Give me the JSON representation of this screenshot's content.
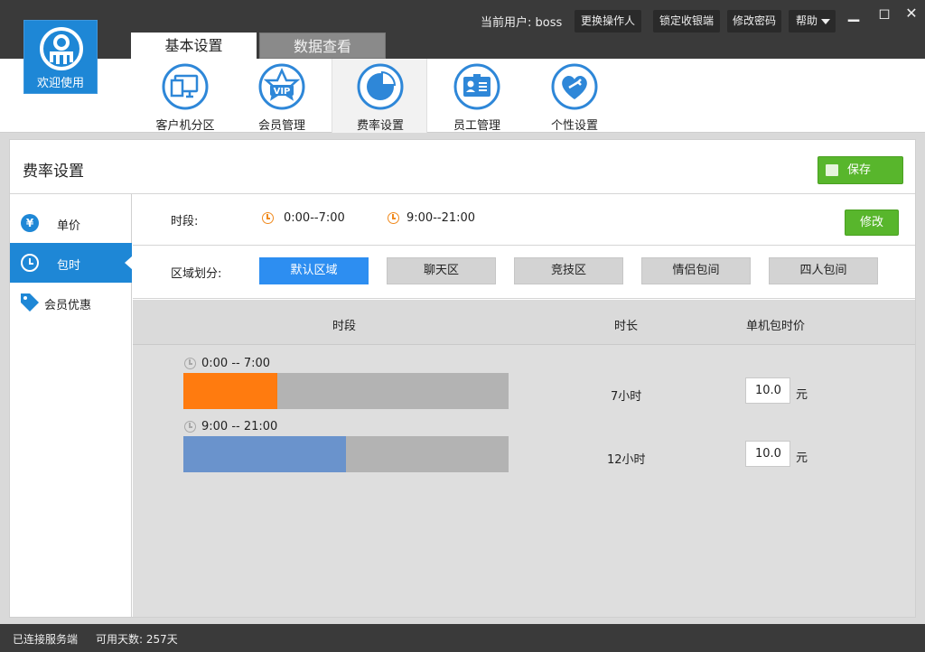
{
  "header": {
    "welcome": "欢迎使用",
    "current_user_label": "当前用户: boss",
    "buttons": {
      "switch_operator": "更换操作人",
      "lock_cashier": "锁定收银端",
      "change_password": "修改密码",
      "help": "帮助"
    },
    "window": {
      "minimize": "▁",
      "maximize": "◻",
      "close": "✕"
    }
  },
  "main_tabs": [
    {
      "label": "基本设置",
      "active": true
    },
    {
      "label": "数据查看",
      "active": false
    }
  ],
  "toolbar": {
    "items": [
      {
        "label": "客户机分区",
        "icon": "monitor-icon"
      },
      {
        "label": "会员管理",
        "icon": "vip-star-icon"
      },
      {
        "label": "费率设置",
        "icon": "pie-chart-icon",
        "active": true
      },
      {
        "label": "员工管理",
        "icon": "id-card-icon"
      },
      {
        "label": "个性设置",
        "icon": "heart-wrench-icon"
      }
    ]
  },
  "panel": {
    "title": "费率设置",
    "save_label": "保存"
  },
  "sidenav": {
    "items": [
      {
        "label": "单价",
        "icon": "yen-icon"
      },
      {
        "label": "包时",
        "icon": "clock-icon",
        "active": true
      },
      {
        "label": "会员优惠",
        "icon": "tag-icon"
      }
    ]
  },
  "period": {
    "label": "时段:",
    "slots": [
      "0:00--7:00",
      "9:00--21:00"
    ],
    "edit_label": "修改"
  },
  "zones": {
    "label": "区域划分:",
    "items": [
      {
        "label": "默认区域",
        "active": true
      },
      {
        "label": "聊天区"
      },
      {
        "label": "竞技区"
      },
      {
        "label": "情侣包间"
      },
      {
        "label": "四人包间"
      }
    ]
  },
  "table": {
    "headers": {
      "period": "时段",
      "duration": "时长",
      "price": "单机包时价"
    },
    "rows": [
      {
        "time": "0:00 -- 7:00",
        "duration": "7小时",
        "price": "10.0",
        "unit": "元",
        "fill_fraction": 0.29,
        "color": "#ff7b0f"
      },
      {
        "time": "9:00 -- 21:00",
        "duration": "12小时",
        "price": "10.0",
        "unit": "元",
        "fill_fraction": 0.5,
        "color": "#6a93cc"
      }
    ]
  },
  "status": {
    "connection": "已连接服务端",
    "days_left": "可用天数: 257天"
  }
}
